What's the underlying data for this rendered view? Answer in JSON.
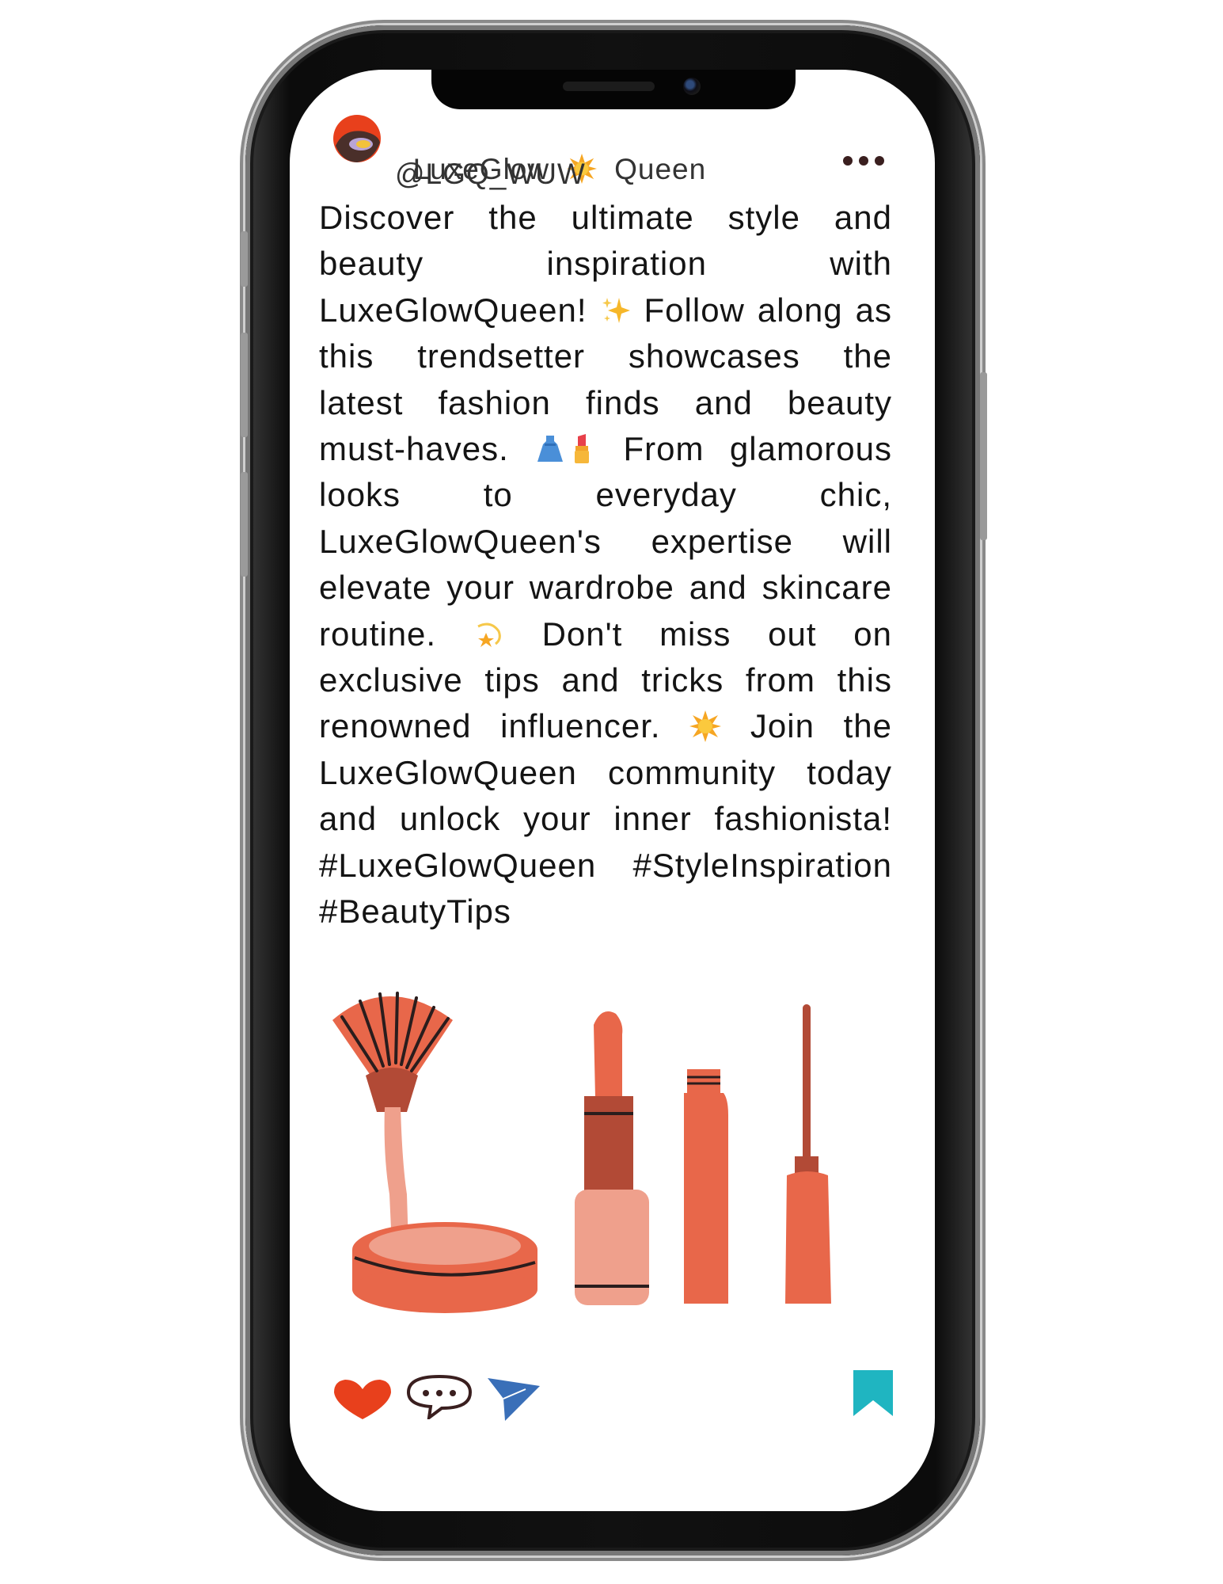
{
  "post": {
    "author": {
      "name_part1": "LuxeGlow",
      "name_part2": "Queen",
      "name_icon": "sun-emoji-icon",
      "handle": "@LGQ_WUW",
      "avatar_icon": "avatar-icon"
    },
    "caption": {
      "segments": [
        "Discover the ultimate style and beauty inspiration with LuxeGlowQueen! ",
        " Follow along as this trendsetter showcases the latest fashion finds and beauty must-haves. ",
        " From glamorous looks to everyday chic, LuxeGlowQueen's expertise will elevate your wardrobe and skincare routine. ",
        " Don't miss out on exclusive tips and tricks from this renowned influencer. ",
        " Join the LuxeGlowQueen community today and unlock your inner fashionista! "
      ],
      "hashtags": [
        "#LuxeGlowQueen",
        "#StyleInspiration",
        "#BeautyTips"
      ],
      "emoji_icons": [
        "sparkles-emoji-icon",
        "dress-emoji-icon",
        "lipstick-emoji-icon",
        "dizzy-star-emoji-icon",
        "glowing-star-emoji-icon"
      ]
    },
    "image": {
      "description_icons": [
        "fan-brush-icon",
        "compact-powder-icon",
        "lipstick-icon",
        "lip-gloss-tube-icon",
        "eyeliner-icon"
      ]
    },
    "actions": {
      "like_icon": "heart-icon",
      "comment_icon": "comment-bubble-icon",
      "share_icon": "send-icon",
      "save_icon": "bookmark-icon"
    }
  },
  "colors": {
    "heart": "#e8401c",
    "share": "#3a6fb8",
    "bookmark": "#1fb5c1",
    "coral": "#e8674a",
    "peach": "#efa08c",
    "rust": "#b24a36",
    "text": "#141414"
  }
}
